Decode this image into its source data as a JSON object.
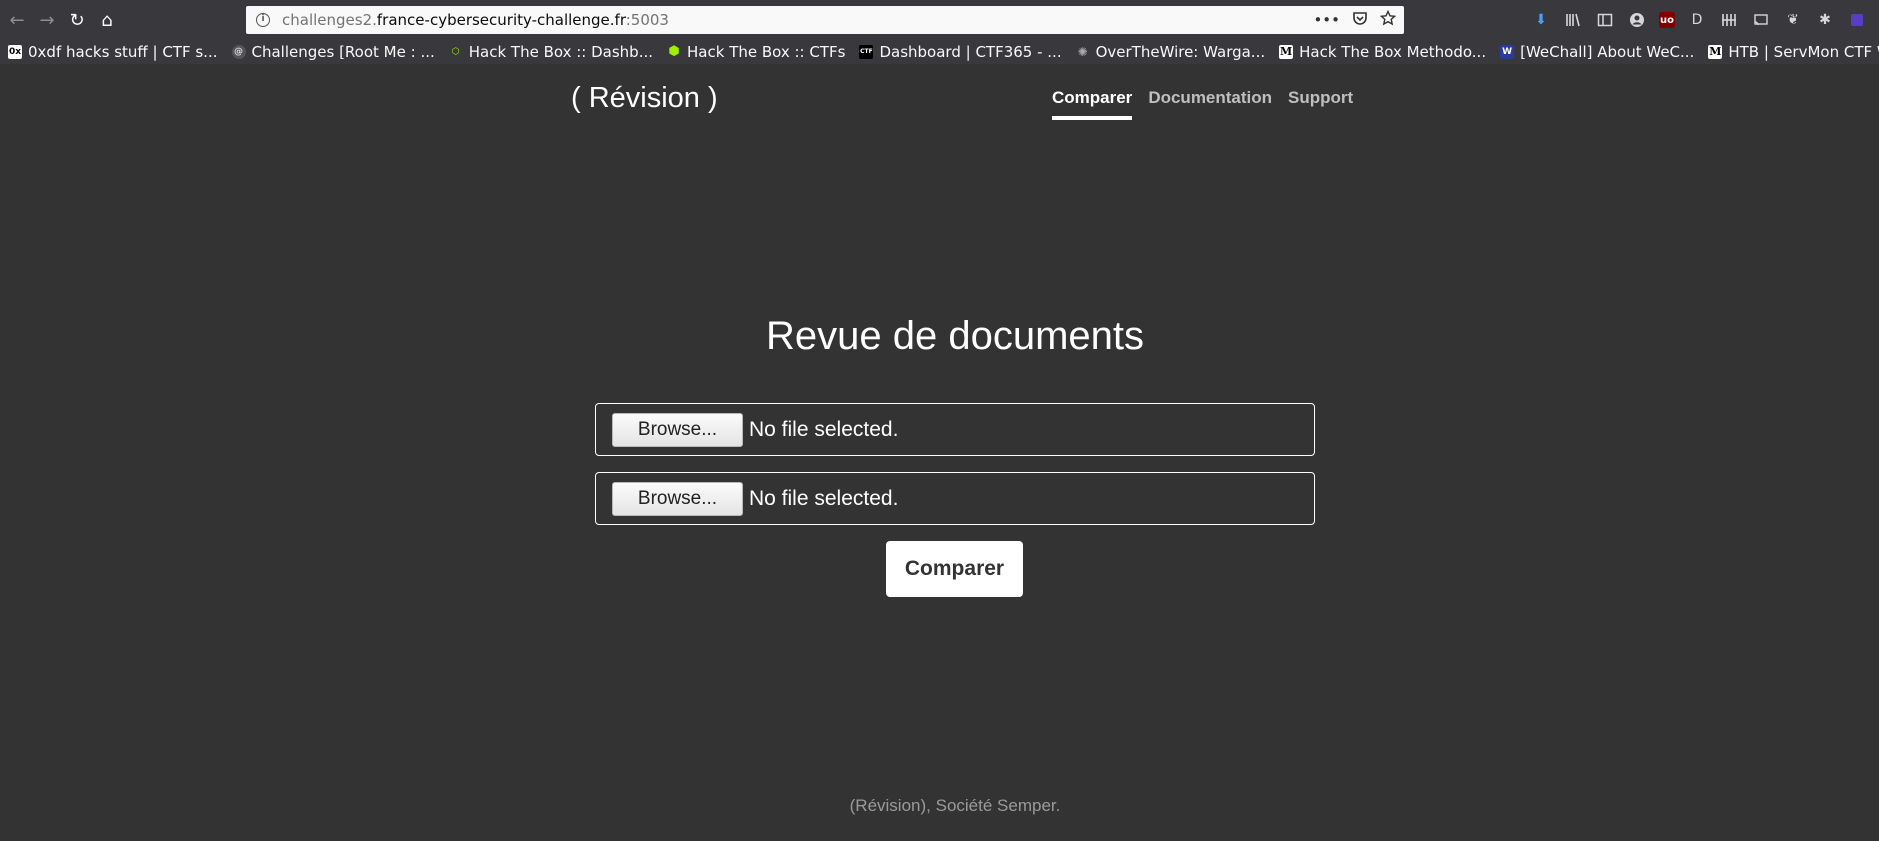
{
  "browser": {
    "url_prefix": "challenges2.",
    "url_host": "france-cybersecurity-challenge.fr",
    "url_port": ":5003",
    "back_glyph": "←",
    "forward_glyph": "→",
    "reload_glyph": "↻",
    "home_glyph": "⌂",
    "page_actions_glyph": "•••",
    "bookmarks": [
      {
        "label": "0xdf hacks stuff | CTF s...",
        "icon": "0xdf-icon",
        "icon_glyph": "0x",
        "color": "#ffffff"
      },
      {
        "label": "Challenges [Root Me : ...",
        "icon": "rootme-icon",
        "icon_glyph": "@",
        "color": "#888888"
      },
      {
        "label": "Hack The Box :: Dashb...",
        "icon": "htb-icon",
        "icon_glyph": "⬡",
        "color": "#9fef00"
      },
      {
        "label": "Hack The Box :: CTFs",
        "icon": "htb-cube-icon",
        "icon_glyph": "⬢",
        "color": "#9fef00"
      },
      {
        "label": "Dashboard | CTF365 - ...",
        "icon": "ctf365-icon",
        "icon_glyph": "CTF",
        "color": "#000000"
      },
      {
        "label": "OverTheWire: Warga...",
        "icon": "overthewire-icon",
        "icon_glyph": "✺",
        "color": "#aaaaaa"
      },
      {
        "label": "Hack The Box Methodo...",
        "icon": "medium-icon",
        "icon_glyph": "M",
        "color": "#ffffff"
      },
      {
        "label": "[WeChall] About WeC...",
        "icon": "wechall-icon",
        "icon_glyph": "W",
        "color": "#4a5bd0"
      },
      {
        "label": "HTB | ServMon CTF W...",
        "icon": "medium-icon-2",
        "icon_glyph": "M",
        "color": "#ffffff"
      }
    ]
  },
  "site": {
    "brand": "( Révision )",
    "nav": [
      {
        "label": "Comparer",
        "active": true
      },
      {
        "label": "Documentation",
        "active": false
      },
      {
        "label": "Support",
        "active": false
      }
    ],
    "heading": "Revue de documents",
    "file_inputs": [
      {
        "button_label": "Browse...",
        "status": "No file selected."
      },
      {
        "button_label": "Browse...",
        "status": "No file selected."
      }
    ],
    "submit_label": "Comparer",
    "footer": "(Révision), Société Semper."
  }
}
